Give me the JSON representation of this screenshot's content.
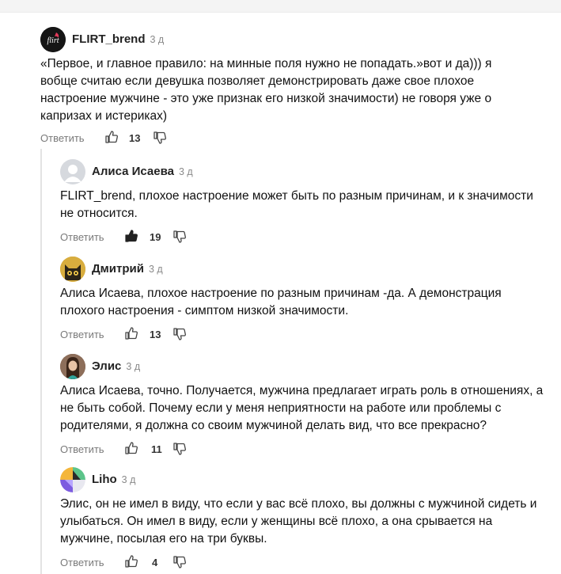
{
  "colors": {
    "accent": "#222222",
    "muted": "#8a8a8a",
    "thread_line": "#e3e3e3"
  },
  "reply_label": "Ответить",
  "comments": [
    {
      "author": "FLIRT_brend",
      "time": "3 д",
      "avatar": "flirt-logo-avatar",
      "text": "«Первое, и главное правило: на минные поля нужно не попадать.»вот и да))) я вобще считаю если девушка позволяет демонстрировать даже свое плохое настроение мужчине - это уже признак его низкой значимости) не говоря уже о капризах и истериках)",
      "likes": "13",
      "liked": false
    },
    {
      "author": "Алиса Исаева",
      "time": "3 д",
      "avatar": "default-avatar",
      "text": "FLIRT_brend, плохое настроение может быть по разным причинам, и к значимости не относится.",
      "likes": "19",
      "liked": true
    },
    {
      "author": "Дмитрий",
      "time": "3 д",
      "avatar": "cat-avatar",
      "text": "Алиса Исаева, плохое настроение по разным причинам -да. А демонстрация плохого настроения - симптом низкой значимости.",
      "likes": "13",
      "liked": false
    },
    {
      "author": "Элис",
      "time": "3 д",
      "avatar": "woman-avatar",
      "text": "Алиса Исаева, точно. Получается, мужчина предлагает играть роль в отношениях, а не быть собой. Почему если у меня неприятности на работе или проблемы с родителями, я должна со своим мужчиной делать вид, что все прекрасно?",
      "likes": "11",
      "liked": false
    },
    {
      "author": "Liho",
      "time": "3 д",
      "avatar": "geometric-avatar",
      "text": "Элис, он не имел в виду, что если у вас всё плохо, вы должны с мужчиной сидеть и улыбаться. Он имел в виду, если у женщины всё плохо, а она срывается на мужчине, посылая его на три буквы.",
      "likes": "4",
      "liked": false
    }
  ]
}
